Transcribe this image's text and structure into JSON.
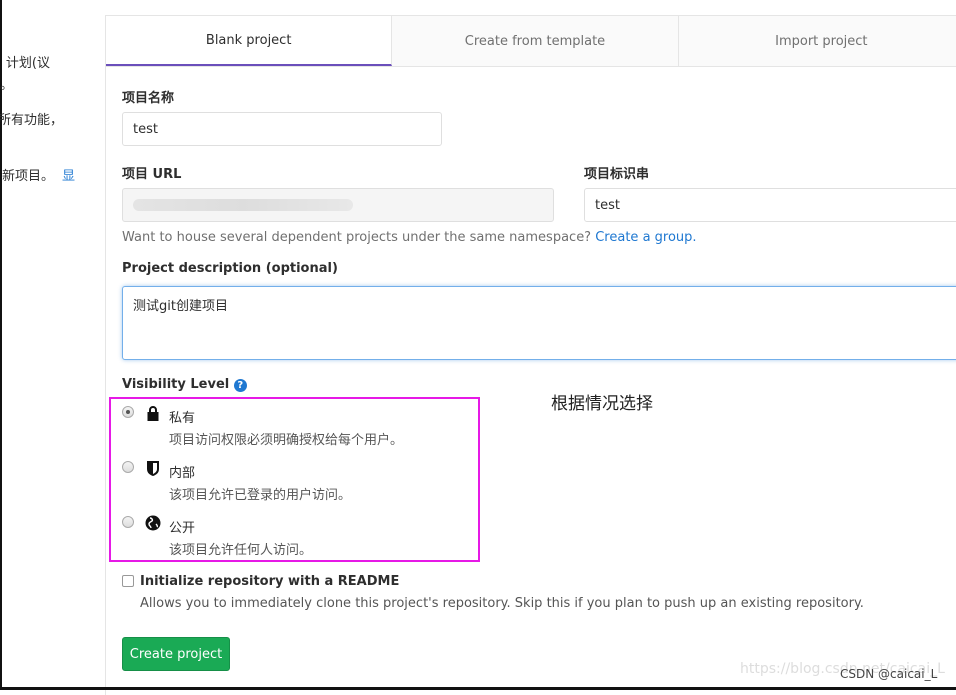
{
  "sidebar_fragments": [
    "计划(议",
    "能。",
    "所有功能，",
    "新项目。"
  ],
  "sidebar_link": "显",
  "tabs": [
    {
      "label": "Blank project",
      "active": true
    },
    {
      "label": "Create from template",
      "active": false
    },
    {
      "label": "Import project",
      "active": false
    }
  ],
  "form": {
    "name_label": "项目名称",
    "name_value": "test",
    "url_label": "项目 URL",
    "url_value": "",
    "slug_label": "项目标识串",
    "slug_value": "test",
    "namespace_help": "Want to house several dependent projects under the same namespace?",
    "namespace_link": "Create a group.",
    "desc_label": "Project description (optional)",
    "desc_value": "测试git创建项目",
    "visibility_label": "Visibility Level",
    "annotation": "根据情况选择",
    "visibility": [
      {
        "title": "私有",
        "desc": "项目访问权限必须明确授权给每个用户。",
        "icon": "lock-icon",
        "selected": true
      },
      {
        "title": "内部",
        "desc": "该项目允许已登录的用户访问。",
        "icon": "shield-icon",
        "selected": false
      },
      {
        "title": "公开",
        "desc": "该项目允许任何人访问。",
        "icon": "globe-icon",
        "selected": false
      }
    ],
    "readme_label": "Initialize repository with a README",
    "readme_checked": false,
    "readme_help": "Allows you to immediately clone this project's repository. Skip this if you plan to push up an existing repository.",
    "create_button": "Create project"
  },
  "highlight_color": "#e619e6",
  "watermark": "https://blog.csdn.net/caicai_L",
  "credit": "CSDN @caicai_L"
}
